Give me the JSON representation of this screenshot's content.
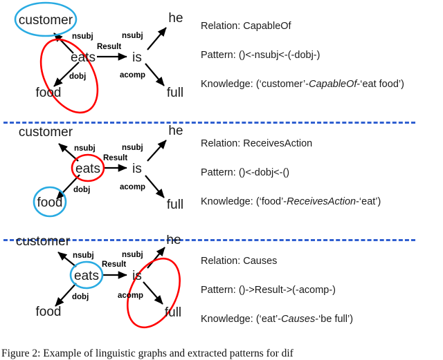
{
  "figure": {
    "caption": "Figure 2: Example of linguistic graphs and extracted patterns for dif",
    "colors": {
      "highlight_red": "#FF0000",
      "highlight_blue": "#29ABE2",
      "divider_blue": "#2F5FD0",
      "text": "#1a1a1a"
    }
  },
  "panels": [
    {
      "id": "panel-capableof",
      "graph": {
        "nodes": [
          {
            "id": "customer",
            "label": "customer",
            "highlight": "blue",
            "shape": "circle"
          },
          {
            "id": "eats",
            "label": "eats",
            "highlight": "none",
            "shape": "none"
          },
          {
            "id": "food",
            "label": "food",
            "highlight": "none",
            "shape": "none"
          },
          {
            "id": "is",
            "label": "is",
            "highlight": "none",
            "shape": "none"
          },
          {
            "id": "he",
            "label": "he",
            "highlight": "none",
            "shape": "none"
          },
          {
            "id": "full",
            "label": "full",
            "highlight": "none",
            "shape": "none"
          }
        ],
        "edges": [
          {
            "from": "eats",
            "to": "customer",
            "label": "nsubj"
          },
          {
            "from": "eats",
            "to": "food",
            "label": "dobj"
          },
          {
            "from": "eats",
            "to": "is",
            "label": "Result"
          },
          {
            "from": "is",
            "to": "he",
            "label": "nsubj"
          },
          {
            "from": "is",
            "to": "full",
            "label": "acomp"
          }
        ],
        "group_highlight": {
          "color": "red",
          "covers": [
            "eats",
            "food"
          ]
        }
      },
      "info": {
        "relation_label": "Relation:",
        "relation_value": "CapableOf",
        "pattern_label": "Pattern:",
        "pattern_value": "()<-nsubj<-(-dobj-)",
        "knowledge_label": "Knowledge:",
        "knowledge_prefix": "(‘customer’-",
        "knowledge_relation": "CapableOf",
        "knowledge_suffix": "-‘eat food’)"
      }
    },
    {
      "id": "panel-receivesaction",
      "graph": {
        "nodes": [
          {
            "id": "customer",
            "label": "customer",
            "highlight": "none",
            "shape": "none"
          },
          {
            "id": "eats",
            "label": "eats",
            "highlight": "red",
            "shape": "circle"
          },
          {
            "id": "food",
            "label": "food",
            "highlight": "blue",
            "shape": "circle"
          },
          {
            "id": "is",
            "label": "is",
            "highlight": "none",
            "shape": "none"
          },
          {
            "id": "he",
            "label": "he",
            "highlight": "none",
            "shape": "none"
          },
          {
            "id": "full",
            "label": "full",
            "highlight": "none",
            "shape": "none"
          }
        ],
        "edges": [
          {
            "from": "eats",
            "to": "customer",
            "label": "nsubj"
          },
          {
            "from": "eats",
            "to": "food",
            "label": "dobj"
          },
          {
            "from": "eats",
            "to": "is",
            "label": "Result"
          },
          {
            "from": "is",
            "to": "he",
            "label": "nsubj"
          },
          {
            "from": "is",
            "to": "full",
            "label": "acomp"
          }
        ],
        "group_highlight": null
      },
      "info": {
        "relation_label": "Relation:",
        "relation_value": "ReceivesAction",
        "pattern_label": "Pattern:",
        "pattern_value": "()<-dobj<-()",
        "knowledge_label": "Knowledge:",
        "knowledge_prefix": "(‘food’-",
        "knowledge_relation": "ReceivesAction",
        "knowledge_suffix": "-‘eat’)"
      }
    },
    {
      "id": "panel-causes",
      "graph": {
        "nodes": [
          {
            "id": "customer",
            "label": "customer",
            "highlight": "none",
            "shape": "none"
          },
          {
            "id": "eats",
            "label": "eats",
            "highlight": "blue",
            "shape": "circle"
          },
          {
            "id": "food",
            "label": "food",
            "highlight": "none",
            "shape": "none"
          },
          {
            "id": "is",
            "label": "is",
            "highlight": "none",
            "shape": "none"
          },
          {
            "id": "he",
            "label": "he",
            "highlight": "none",
            "shape": "none"
          },
          {
            "id": "full",
            "label": "full",
            "highlight": "none",
            "shape": "none"
          }
        ],
        "edges": [
          {
            "from": "eats",
            "to": "customer",
            "label": "nsubj"
          },
          {
            "from": "eats",
            "to": "food",
            "label": "dobj"
          },
          {
            "from": "eats",
            "to": "is",
            "label": "Result"
          },
          {
            "from": "is",
            "to": "he",
            "label": "nsubj"
          },
          {
            "from": "is",
            "to": "full",
            "label": "acomp"
          }
        ],
        "group_highlight": {
          "color": "red",
          "covers": [
            "is",
            "full"
          ]
        }
      },
      "info": {
        "relation_label": "Relation:",
        "relation_value": "Causes",
        "pattern_label": "Pattern:",
        "pattern_value": "()->Result->(-acomp-)",
        "knowledge_label": "Knowledge:",
        "knowledge_prefix": "(‘eat’-",
        "knowledge_relation": "Causes",
        "knowledge_suffix": "-‘be full’)"
      }
    }
  ]
}
